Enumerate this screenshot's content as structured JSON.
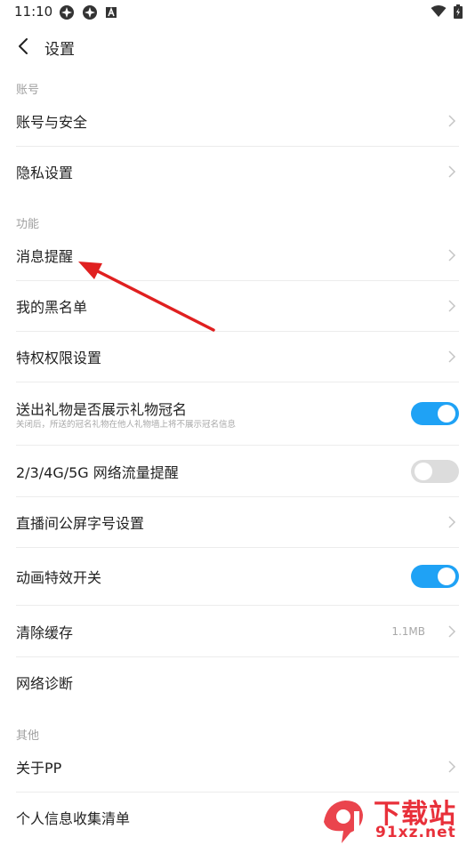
{
  "status_bar": {
    "time": "11:10",
    "left_icons": [
      "app-icon",
      "app-icon",
      "a-icon"
    ],
    "right_icons": [
      "wifi-icon",
      "battery-icon"
    ]
  },
  "header": {
    "title": "设置",
    "back_icon": "chevron-left-icon"
  },
  "sections": {
    "account": {
      "label": "账号",
      "items": [
        {
          "label": "账号与安全"
        },
        {
          "label": "隐私设置"
        }
      ]
    },
    "features": {
      "label": "功能",
      "items": [
        {
          "label": "消息提醒"
        },
        {
          "label": "我的黑名单"
        },
        {
          "label": "特权权限设置"
        },
        {
          "label": "送出礼物是否展示礼物冠名",
          "sub": "关闭后，所送的冠名礼物在他人礼物墙上将不展示冠名信息",
          "toggle": true
        },
        {
          "label": "2/3/4G/5G 网络流量提醒",
          "toggle": false
        },
        {
          "label": "直播间公屏字号设置"
        },
        {
          "label": "动画特效开关",
          "toggle": true
        },
        {
          "label": "清除缓存",
          "value": "1.1MB"
        },
        {
          "label": "网络诊断"
        }
      ]
    },
    "other": {
      "label": "其他",
      "items": [
        {
          "label": "关于PP"
        },
        {
          "label": "个人信息收集清单"
        }
      ]
    }
  },
  "watermark": {
    "top": "下载站",
    "bottom": "91xz.net"
  },
  "colors": {
    "toggle_on": "#1fa2f5",
    "toggle_off": "#dcdcdc",
    "annotation_arrow": "#e02020",
    "watermark": "#e8303a"
  }
}
